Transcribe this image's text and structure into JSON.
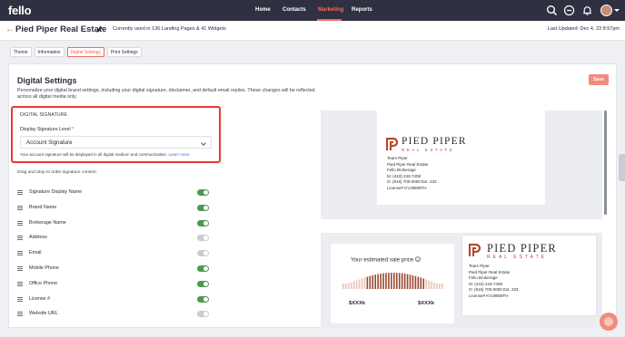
{
  "app": {
    "logo": "fello"
  },
  "nav": {
    "items": [
      "Home",
      "Contacts",
      "Marketing",
      "Reports"
    ],
    "active": "Marketing"
  },
  "header": {
    "title": "Pied Piper Real Estate",
    "usage": "Currently used in 136 Landing Pages & 41 Widgets",
    "last_updated": "Last Updated: Dec 4, 23 8:57pm"
  },
  "tabs": [
    "Theme",
    "Information",
    "Digital Settings",
    "Print Settings"
  ],
  "active_tab": "Digital Settings",
  "settings": {
    "title": "Digital Settings",
    "description": "Personalize your digital brand settings, including your digital signature, disclaimer, and default email replies. These changes will be reflected across all digital media only.",
    "save_label": "Save",
    "signature": {
      "heading": "DIGITAL SIGNATURE",
      "level_label": "Display Signature Level",
      "required_mark": "*",
      "level_value": "Account Signature",
      "note": "Your account signature will be displayed in all digital medium and communication.",
      "learn_more": "Learn more"
    },
    "drag_note": "Drag and drop to order signature content.",
    "fields": [
      {
        "label": "Signature Display Name",
        "on": true
      },
      {
        "label": "Brand Name",
        "on": true
      },
      {
        "label": "Brokerage Name",
        "on": true
      },
      {
        "label": "Address",
        "on": false
      },
      {
        "label": "Email",
        "on": false
      },
      {
        "label": "Mobile Phone",
        "on": true
      },
      {
        "label": "Office Phone",
        "on": true
      },
      {
        "label": "License #",
        "on": true
      },
      {
        "label": "Website URL",
        "on": false
      }
    ]
  },
  "preview": {
    "brand_name": "PIED PIPER",
    "brand_sub": "REAL ESTATE",
    "team": "Team Piper",
    "company": "Pied Piper Real Estate",
    "brokerage": "Fello Brokerage",
    "mobile": "M: (443) 243-7408",
    "office": "O: (916) 700-0000 Ext. 233",
    "license": "License# KVJ9908TH",
    "price_title": "Your estimated sale price",
    "price_low": "$XXXk",
    "price_high": "$XXXk",
    "colors": {
      "accent": "#f06b5d",
      "brand": "#b5462f",
      "nav": "#2f3142",
      "highlight": "#e43a34"
    }
  }
}
